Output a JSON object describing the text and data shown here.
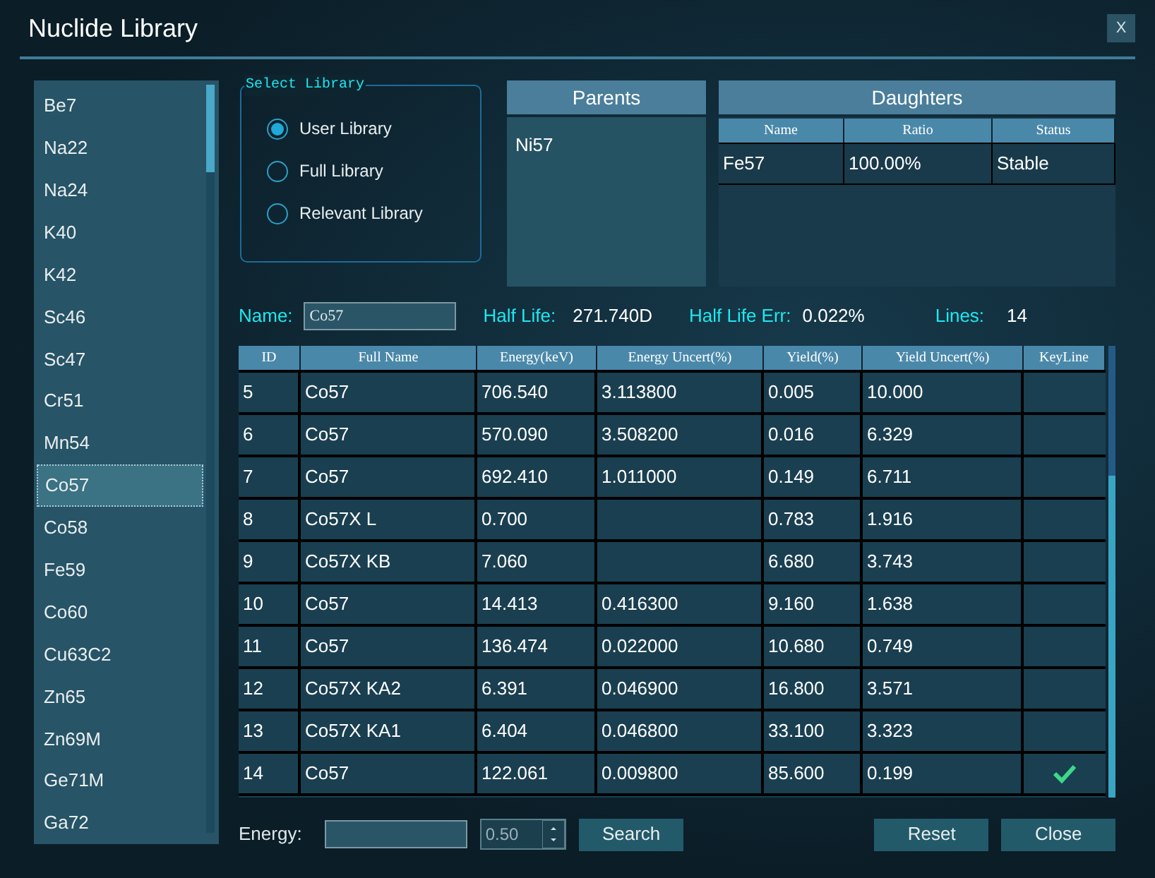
{
  "window": {
    "title": "Nuclide Library",
    "close_label": "X"
  },
  "nuclides": [
    {
      "name": "Be7",
      "selected": false
    },
    {
      "name": "Na22",
      "selected": false
    },
    {
      "name": "Na24",
      "selected": false
    },
    {
      "name": "K40",
      "selected": false
    },
    {
      "name": "K42",
      "selected": false
    },
    {
      "name": "Sc46",
      "selected": false
    },
    {
      "name": "Sc47",
      "selected": false
    },
    {
      "name": "Cr51",
      "selected": false
    },
    {
      "name": "Mn54",
      "selected": false
    },
    {
      "name": "Co57",
      "selected": true
    },
    {
      "name": "Co58",
      "selected": false
    },
    {
      "name": "Fe59",
      "selected": false
    },
    {
      "name": "Co60",
      "selected": false
    },
    {
      "name": "Cu63C2",
      "selected": false
    },
    {
      "name": "Zn65",
      "selected": false
    },
    {
      "name": "Zn69M",
      "selected": false
    },
    {
      "name": "Ge71M",
      "selected": false
    },
    {
      "name": "Ga72",
      "selected": false
    }
  ],
  "select_library": {
    "title": "Select Library",
    "options": [
      {
        "label": "User Library",
        "selected": true
      },
      {
        "label": "Full Library",
        "selected": false
      },
      {
        "label": "Relevant Library",
        "selected": false
      }
    ]
  },
  "parents": {
    "title": "Parents",
    "items": [
      "Ni57"
    ]
  },
  "daughters": {
    "title": "Daughters",
    "columns": [
      "Name",
      "Ratio",
      "Status"
    ],
    "rows": [
      [
        "Fe57",
        "100.00%",
        "Stable"
      ]
    ]
  },
  "info": {
    "name_label": "Name:",
    "name_value": "Co57",
    "half_life_label": "Half Life:",
    "half_life": "271.740D",
    "half_life_err_label": "Half Life Err:",
    "half_life_err": "0.022%",
    "lines_label": "Lines:",
    "lines": "14"
  },
  "table": {
    "columns": [
      "ID",
      "Full Name",
      "Energy(keV)",
      "Energy Uncert(%)",
      "Yield(%)",
      "Yield Uncert(%)",
      "KeyLine"
    ],
    "rows": [
      {
        "cells": [
          "5",
          "Co57",
          "706.540",
          "3.113800",
          "0.005",
          "10.000"
        ],
        "keyline": false
      },
      {
        "cells": [
          "6",
          "Co57",
          "570.090",
          "3.508200",
          "0.016",
          "6.329"
        ],
        "keyline": false
      },
      {
        "cells": [
          "7",
          "Co57",
          "692.410",
          "1.011000",
          "0.149",
          "6.711"
        ],
        "keyline": false
      },
      {
        "cells": [
          "8",
          "Co57X L",
          "0.700",
          "",
          "0.783",
          "1.916"
        ],
        "keyline": false
      },
      {
        "cells": [
          "9",
          "Co57X KB",
          "7.060",
          "",
          "6.680",
          "3.743"
        ],
        "keyline": false
      },
      {
        "cells": [
          "10",
          "Co57",
          "14.413",
          "0.416300",
          "9.160",
          "1.638"
        ],
        "keyline": false
      },
      {
        "cells": [
          "11",
          "Co57",
          "136.474",
          "0.022000",
          "10.680",
          "0.749"
        ],
        "keyline": false
      },
      {
        "cells": [
          "12",
          "Co57X KA2",
          "6.391",
          "0.046900",
          "16.800",
          "3.571"
        ],
        "keyline": false
      },
      {
        "cells": [
          "13",
          "Co57X KA1",
          "6.404",
          "0.046800",
          "33.100",
          "3.323"
        ],
        "keyline": false
      },
      {
        "cells": [
          "14",
          "Co57",
          "122.061",
          "0.009800",
          "85.600",
          "0.199"
        ],
        "keyline": true
      }
    ]
  },
  "footer": {
    "energy_label": "Energy:",
    "tolerance": "0.50",
    "buttons": [
      "Search",
      "Reset",
      "Close"
    ]
  }
}
